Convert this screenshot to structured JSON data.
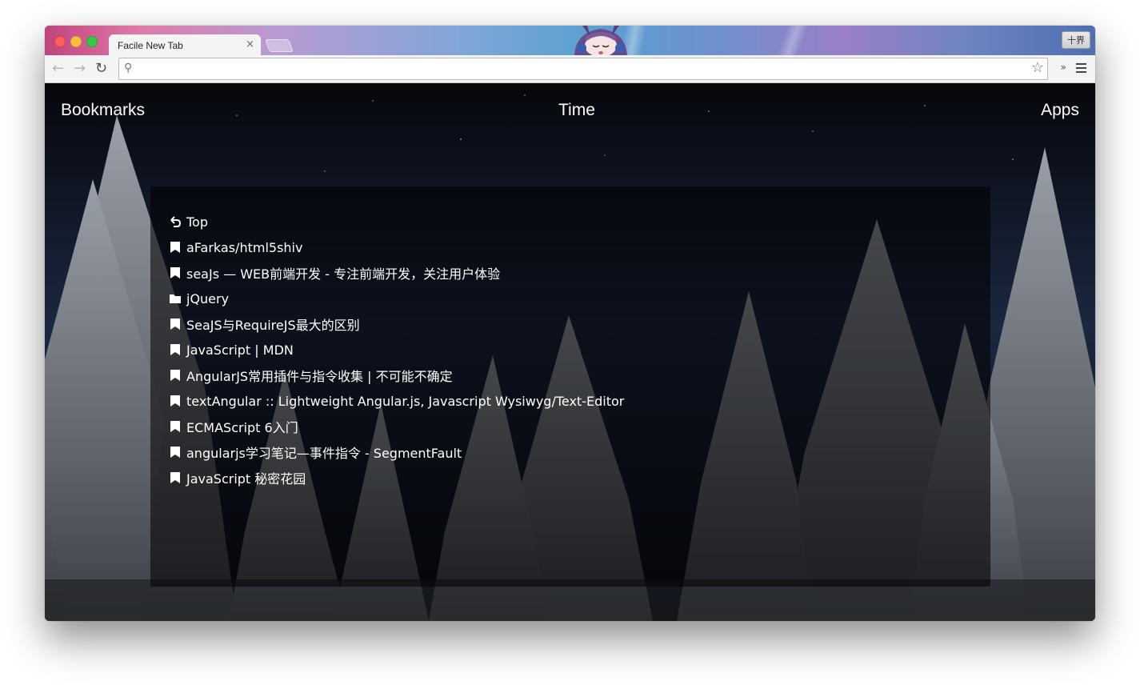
{
  "browser": {
    "tab_title": "Facile New Tab",
    "tab_close": "×",
    "profile_label": "十界",
    "address_value": "",
    "address_placeholder": ""
  },
  "nav": {
    "bookmarks": "Bookmarks",
    "time": "Time",
    "apps": "Apps"
  },
  "bookmarks": [
    {
      "label": "Top",
      "icon": "back-arrow-icon"
    },
    {
      "label": "aFarkas/html5shiv",
      "icon": "bookmark-icon"
    },
    {
      "label": "seaJs — WEB前端开发 - 专注前端开发，关注用户体验",
      "icon": "bookmark-icon"
    },
    {
      "label": "jQuery",
      "icon": "folder-icon"
    },
    {
      "label": "SeaJS与RequireJS最大的区别",
      "icon": "bookmark-icon"
    },
    {
      "label": "JavaScript | MDN",
      "icon": "bookmark-icon"
    },
    {
      "label": "AngularJS常用插件与指令收集 | 不可能不确定",
      "icon": "bookmark-icon"
    },
    {
      "label": "textAngular :: Lightweight Angular.js, Javascript Wysiwyg/Text-Editor",
      "icon": "bookmark-icon"
    },
    {
      "label": "ECMAScript 6入门",
      "icon": "bookmark-icon"
    },
    {
      "label": "angularjs学习笔记—事件指令 - SegmentFault",
      "icon": "bookmark-icon"
    },
    {
      "label": "JavaScript 秘密花园",
      "icon": "bookmark-icon"
    }
  ],
  "colors": {
    "text": "#ffffff",
    "panel": "rgba(0,0,0,0.55)",
    "tab": "#f4f4f4"
  }
}
